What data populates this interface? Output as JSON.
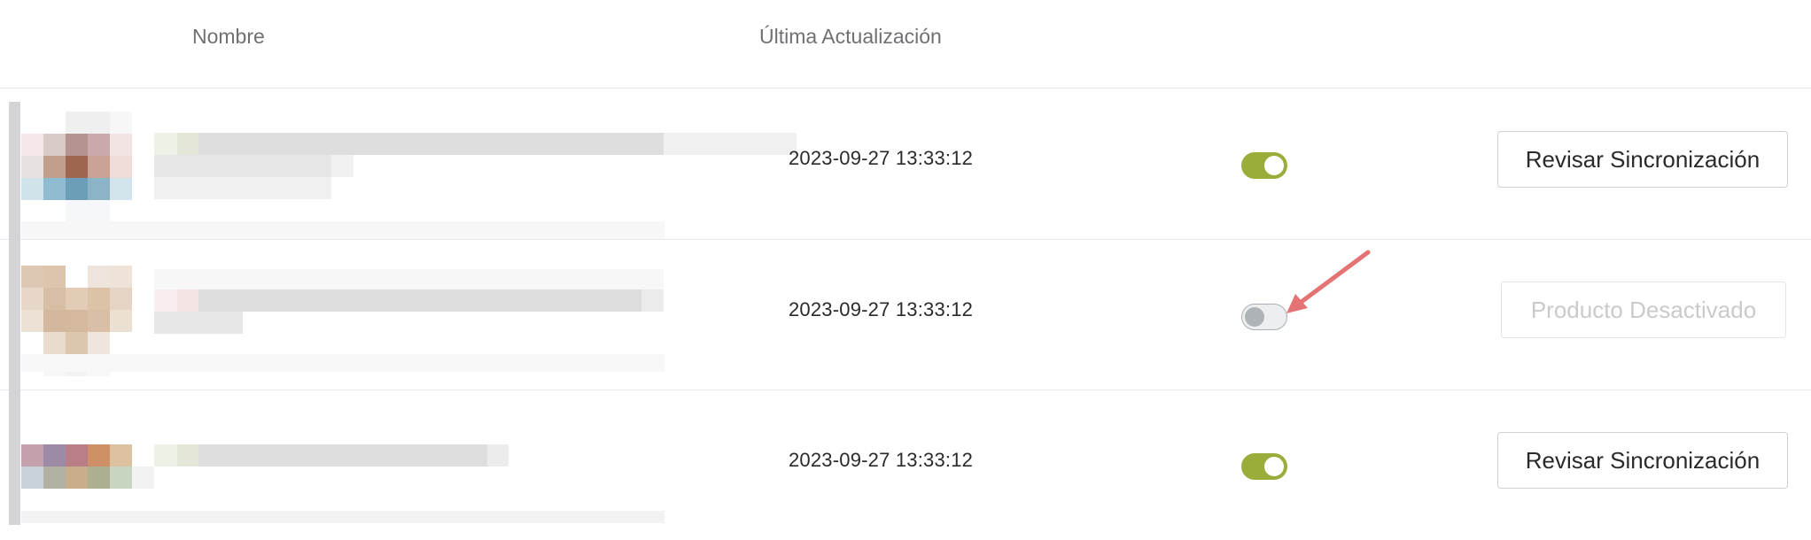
{
  "table": {
    "headers": {
      "name": "Nombre",
      "last_update": "Última Actualización"
    },
    "rows": [
      {
        "date": "2023-09-27 13:33:12",
        "enabled": true,
        "action_label": "Revisar Sincronización",
        "action_state": "enabled"
      },
      {
        "date": "2023-09-27 13:33:12",
        "enabled": false,
        "action_label": "Producto Desactivado",
        "action_state": "disabled"
      },
      {
        "date": "2023-09-27 13:33:12",
        "enabled": true,
        "action_label": "Revisar Sincronización",
        "action_state": "enabled"
      }
    ]
  },
  "colors": {
    "toggle_on": "#9aad3a",
    "toggle_off": "#eceef0",
    "annotation_arrow": "#e57373"
  }
}
